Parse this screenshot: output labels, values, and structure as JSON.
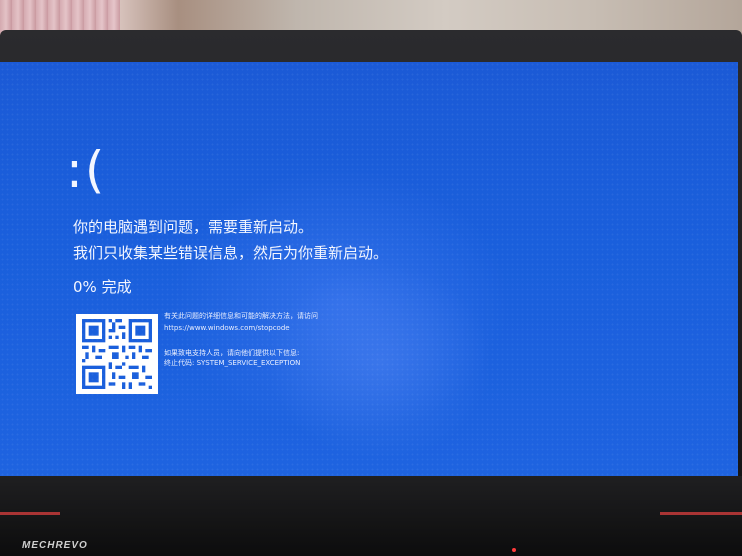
{
  "screen": {
    "frown": ":(",
    "message_line1": "你的电脑遇到问题，需要重新启动。",
    "message_line2": "我们只收集某些错误信息，然后为你重新启动。",
    "progress_text": "0% 完成",
    "info_line1": "有关此问题的详细信息和可能的解决方法，请访问",
    "info_line2": "https://www.windows.com/stopcode",
    "info_line3": "如果致电支持人员，请向他们提供以下信息:",
    "info_line4": "终止代码: SYSTEM_SERVICE_EXCEPTION"
  },
  "laptop": {
    "brand": "MECHREVO"
  },
  "colors": {
    "screen_blue": "#1a5fdc",
    "text": "#f3f6ff",
    "accent_red": "#c33a3a"
  }
}
